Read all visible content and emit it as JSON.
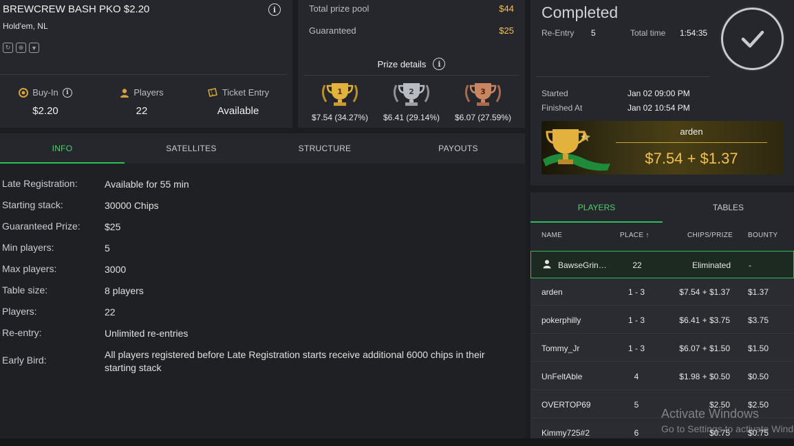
{
  "tournament": {
    "name": "BREWCREW BASH PKO $2.20",
    "game": "Hold'em, NL",
    "stats": [
      {
        "label": "Buy-In",
        "value": "$2.20"
      },
      {
        "label": "Players",
        "value": "22"
      },
      {
        "label": "Ticket Entry",
        "value": "Available"
      }
    ]
  },
  "prize_pool": {
    "total_label": "Total prize pool",
    "total_value": "$44",
    "guaranteed_label": "Guaranteed",
    "guaranteed_value": "$25",
    "details_label": "Prize details",
    "places": [
      {
        "rank": "1",
        "amount": "$7.54 (34.27%)",
        "color": "#e2b23c"
      },
      {
        "rank": "2",
        "amount": "$6.41 (29.14%)",
        "color": "#b8bcc2"
      },
      {
        "rank": "3",
        "amount": "$6.07 (27.59%)",
        "color": "#c98462"
      }
    ]
  },
  "status": {
    "title": "Completed",
    "reentry_label": "Re-Entry",
    "reentry_value": "5",
    "total_time_label": "Total time",
    "total_time_value": "1:54:35",
    "started_label": "Started",
    "started_value": "Jan 02 09:00 PM",
    "finished_label": "Finished At",
    "finished_value": "Jan 02 10:54 PM",
    "winner_name": "arden",
    "winner_prize": "$7.54 + $1.37"
  },
  "tabs": [
    "INFO",
    "SATELLITES",
    "STRUCTURE",
    "PAYOUTS"
  ],
  "info": [
    {
      "key": "Late Registration:",
      "value": "Available for 55 min"
    },
    {
      "key": "Starting stack:",
      "value": "30000 Chips"
    },
    {
      "key": "Guaranteed Prize:",
      "value": "$25"
    },
    {
      "key": "Min players:",
      "value": "5"
    },
    {
      "key": "Max players:",
      "value": "3000"
    },
    {
      "key": "Table size:",
      "value": "8 players"
    },
    {
      "key": "Players:",
      "value": "22"
    },
    {
      "key": "Re-entry:",
      "value": "Unlimited re-entries"
    },
    {
      "key": "Early Bird:",
      "value": "All players registered before Late Registration starts receive additional 6000 chips in their starting stack"
    }
  ],
  "player_tabs": [
    "PLAYERS",
    "TABLES"
  ],
  "players_table": {
    "headers": [
      "NAME",
      "PLACE ↑",
      "CHIPS/PRIZE",
      "BOUNTY"
    ],
    "rows": [
      {
        "name": "BawseGrin…",
        "place": "22",
        "chips": "Eliminated",
        "bounty": "-",
        "me": true
      },
      {
        "name": "arden",
        "place": "1 - 3",
        "chips": "$7.54 + $1.37",
        "bounty": "$1.37"
      },
      {
        "name": "pokerphilly",
        "place": "1 - 3",
        "chips": "$6.41 + $3.75",
        "bounty": "$3.75"
      },
      {
        "name": "Tommy_Jr",
        "place": "1 - 3",
        "chips": "$6.07 + $1.50",
        "bounty": "$1.50"
      },
      {
        "name": "UnFeltAble",
        "place": "4",
        "chips": "$1.98 + $0.50",
        "bounty": "$0.50"
      },
      {
        "name": "OVERTOP69",
        "place": "5",
        "chips": "$2.50",
        "bounty": "$2.50"
      },
      {
        "name": "Kimmy725#2",
        "place": "6",
        "chips": "$0.75",
        "bounty": "$0.75"
      }
    ]
  },
  "watermark": {
    "line1": "Activate Windows",
    "line2": "Go to Settings to activate Windows."
  }
}
